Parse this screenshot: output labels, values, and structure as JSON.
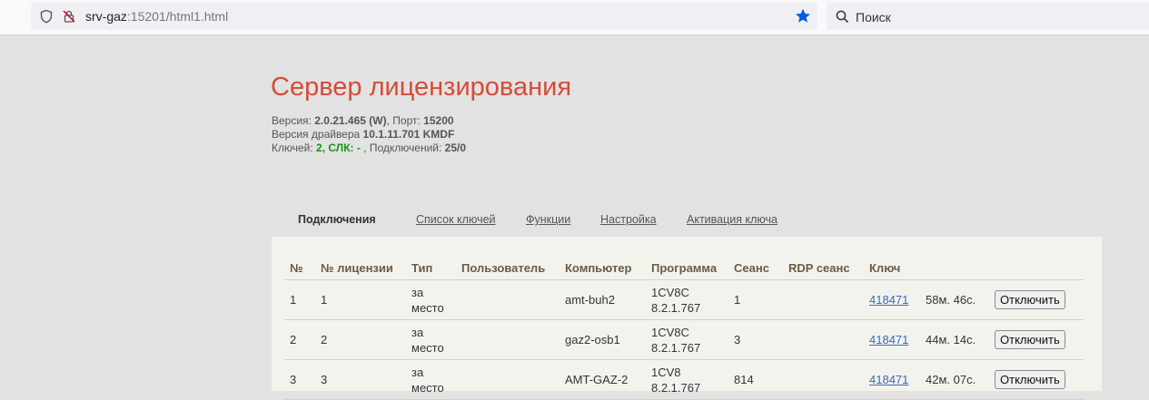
{
  "browser": {
    "url_host": "srv-gaz",
    "url_rest": ":15201/html1.html",
    "search_placeholder": "Поиск",
    "bookmark_color": "#0060df"
  },
  "page": {
    "title": "Сервер лицензирования",
    "version_label": "Версия:",
    "version_value": "2.0.21.465 (W)",
    "port_label": ", Порт:",
    "port_value": "15200",
    "driver_label": "Версия драйвера",
    "driver_value": "10.1.11.701 KMDF",
    "keys_label": "Ключей:",
    "keys_value": "2,",
    "slk_label": "СЛК: -",
    "conn_label": ", Подключений:",
    "conn_value": "25/0"
  },
  "tabs": [
    {
      "label": "Подключения",
      "active": true
    },
    {
      "label": "Список ключей"
    },
    {
      "label": "Функции"
    },
    {
      "label": "Настройка"
    },
    {
      "label": "Активация ключа"
    }
  ],
  "table": {
    "headers": [
      "№",
      "№ лицензии",
      "Тип",
      "Пользователь",
      "Компьютер",
      "Программа",
      "Сеанс",
      "RDP сеанс",
      "Ключ",
      "",
      ""
    ],
    "rows": [
      {
        "n": "1",
        "lic": "1",
        "type": "за место",
        "user": "",
        "pc": "amt-buh2",
        "prog": "1CV8C 8.2.1.767",
        "session": "1",
        "rdp": "",
        "key": "418471",
        "time": "58м. 46с.",
        "action": "Отключить"
      },
      {
        "n": "2",
        "lic": "2",
        "type": "за место",
        "user": "",
        "pc": "gaz2-osb1",
        "prog": "1CV8C 8.2.1.767",
        "session": "3",
        "rdp": "",
        "key": "418471",
        "time": "44м. 14с.",
        "action": "Отключить"
      },
      {
        "n": "3",
        "lic": "3",
        "type": "за место",
        "user": "",
        "pc": "AMT-GAZ-2",
        "prog": "1CV8 8.2.1.767",
        "session": "814",
        "rdp": "",
        "key": "418471",
        "time": "42м. 07с.",
        "action": "Отключить"
      }
    ]
  }
}
